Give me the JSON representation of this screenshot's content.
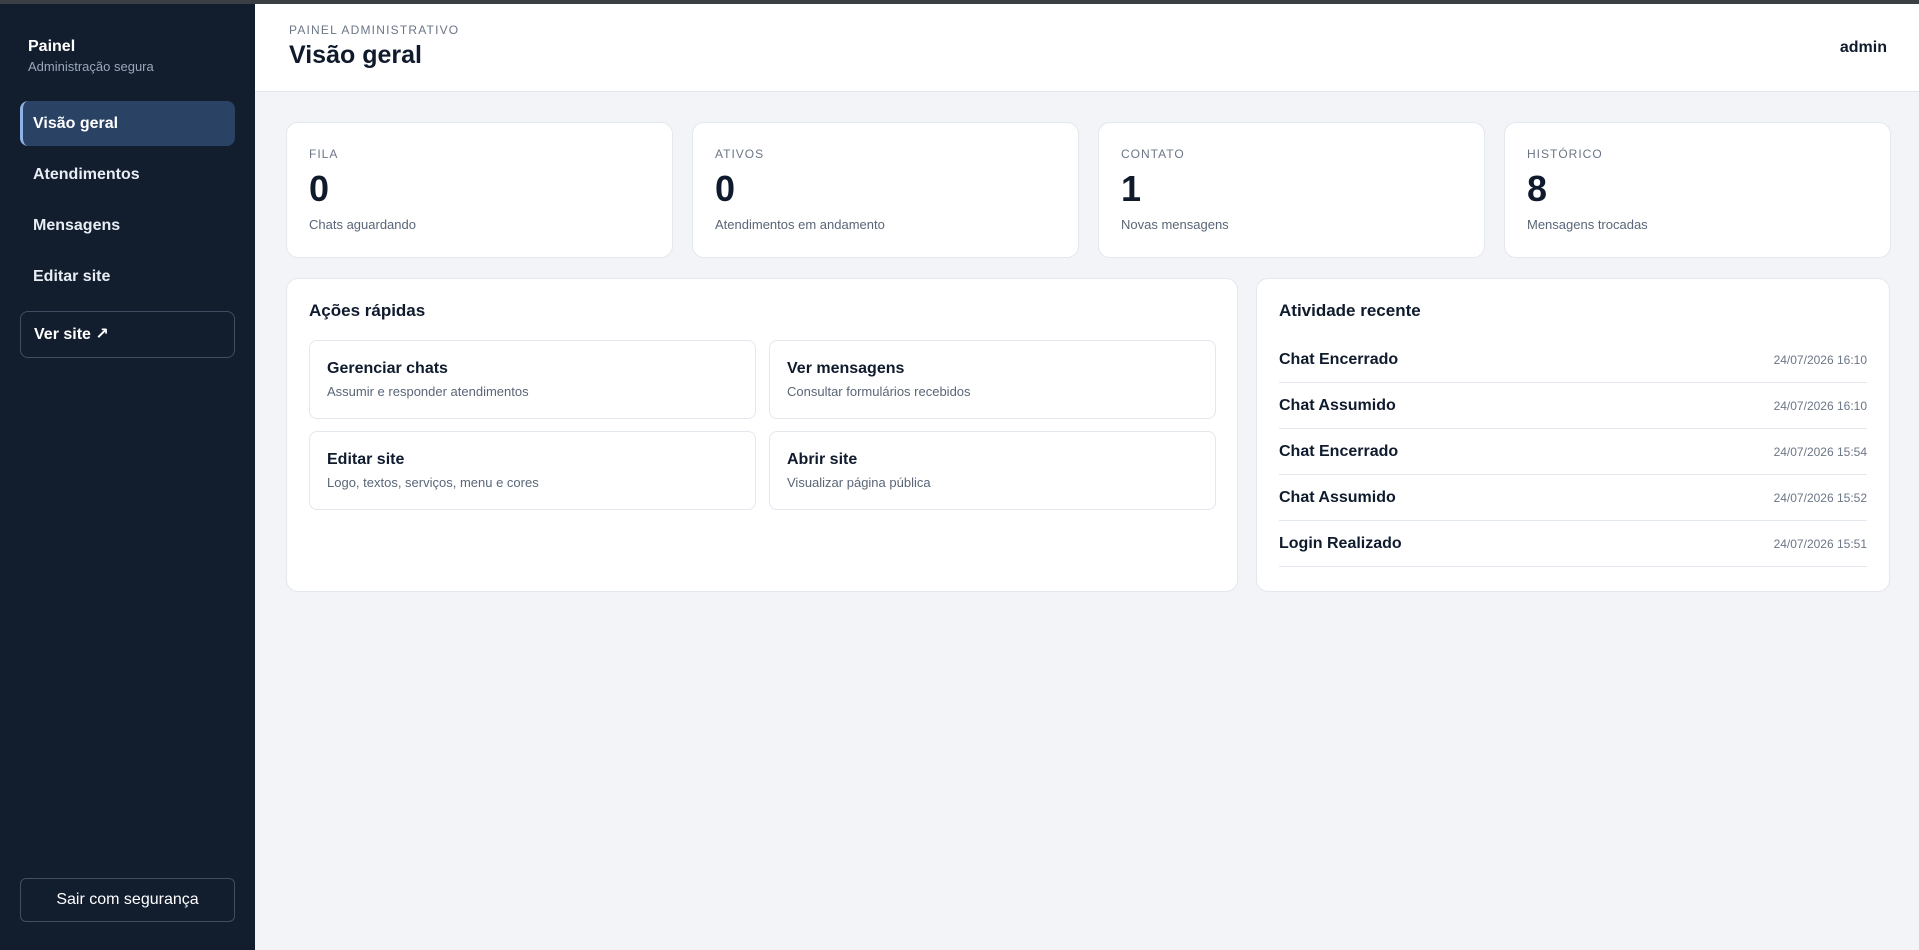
{
  "sidebar": {
    "brand_title": "Painel",
    "brand_subtitle": "Administração segura",
    "items": [
      {
        "label": "Visão geral",
        "active": true
      },
      {
        "label": "Atendimentos",
        "active": false
      },
      {
        "label": "Mensagens",
        "active": false
      },
      {
        "label": "Editar site",
        "active": false
      }
    ],
    "view_site_label": "Ver site ↗",
    "logout_label": "Sair com segurança"
  },
  "header": {
    "eyebrow": "PAINEL ADMINISTRATIVO",
    "title": "Visão geral",
    "user": "admin"
  },
  "stats": [
    {
      "label": "FILA",
      "value": "0",
      "description": "Chats aguardando"
    },
    {
      "label": "ATIVOS",
      "value": "0",
      "description": "Atendimentos em andamento"
    },
    {
      "label": "CONTATO",
      "value": "1",
      "description": "Novas mensagens"
    },
    {
      "label": "HISTÓRICO",
      "value": "8",
      "description": "Mensagens trocadas"
    }
  ],
  "quick_actions": {
    "title": "Ações rápidas",
    "items": [
      {
        "title": "Gerenciar chats",
        "description": "Assumir e responder atendimentos"
      },
      {
        "title": "Ver mensagens",
        "description": "Consultar formulários recebidos"
      },
      {
        "title": "Editar site",
        "description": "Logo, textos, serviços, menu e cores"
      },
      {
        "title": "Abrir site",
        "description": "Visualizar página pública"
      }
    ]
  },
  "activity": {
    "title": "Atividade recente",
    "items": [
      {
        "name": "Chat Encerrado",
        "time": "24/07/2026 16:10"
      },
      {
        "name": "Chat Assumido",
        "time": "24/07/2026 16:10"
      },
      {
        "name": "Chat Encerrado",
        "time": "24/07/2026 15:54"
      },
      {
        "name": "Chat Assumido",
        "time": "24/07/2026 15:52"
      },
      {
        "name": "Login Realizado",
        "time": "24/07/2026 15:51"
      }
    ]
  },
  "colors": {
    "sidebar_bg": "#121d2e",
    "active_item_bg": "#2a4263",
    "page_bg": "#f2f4f7",
    "text_primary": "#0f1b2d"
  }
}
